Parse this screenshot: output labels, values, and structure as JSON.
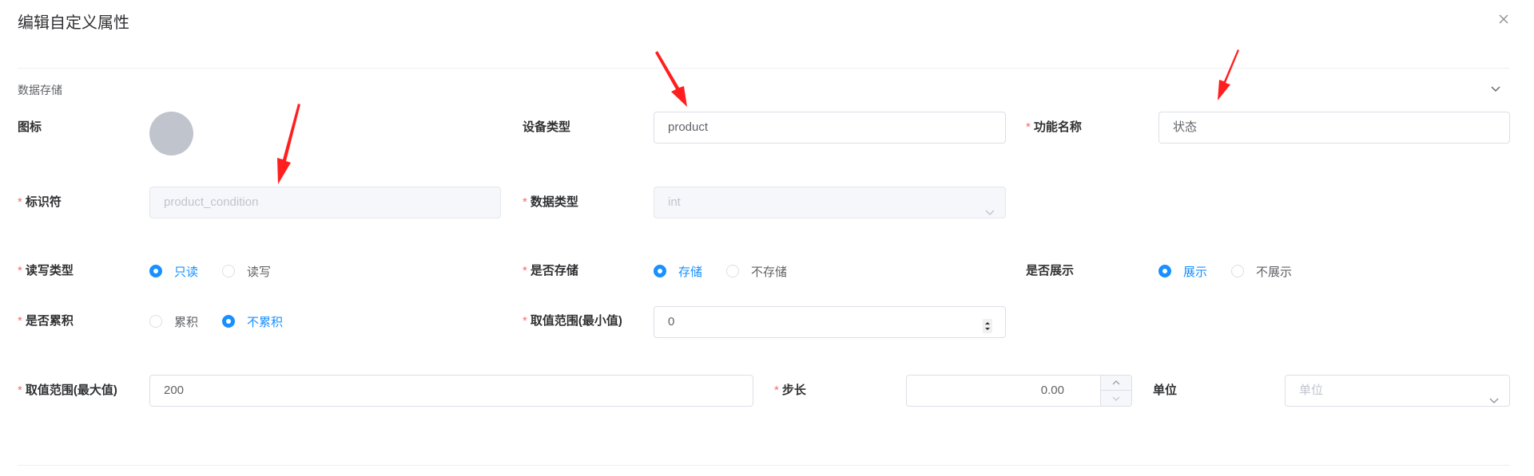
{
  "dialog": {
    "title": "编辑自定义属性"
  },
  "section": {
    "title": "数据存储"
  },
  "fields": {
    "icon": {
      "label": "图标"
    },
    "device_type": {
      "label": "设备类型",
      "value": "product"
    },
    "function_name": {
      "label": "功能名称",
      "required": "*",
      "value": "状态"
    },
    "identifier": {
      "label": "标识符",
      "required": "*",
      "value": "product_condition"
    },
    "data_type": {
      "label": "数据类型",
      "required": "*",
      "value": "int"
    },
    "rw_type": {
      "label": "读写类型",
      "required": "*",
      "options": [
        "只读",
        "读写"
      ],
      "selected": "只读"
    },
    "is_stored": {
      "label": "是否存储",
      "required": "*",
      "options": [
        "存储",
        "不存储"
      ],
      "selected": "存储"
    },
    "is_shown": {
      "label": "是否展示",
      "options": [
        "展示",
        "不展示"
      ],
      "selected": "展示"
    },
    "is_cumulative": {
      "label": "是否累积",
      "required": "*",
      "options": [
        "累积",
        "不累积"
      ],
      "selected": "不累积"
    },
    "range_min": {
      "label": "取值范围(最小值)",
      "required": "*",
      "value": "0"
    },
    "range_max": {
      "label": "取值范围(最大值)",
      "required": "*",
      "value": "200"
    },
    "step": {
      "label": "步长",
      "required": "*",
      "value": "0.00"
    },
    "unit": {
      "label": "单位",
      "placeholder": "单位"
    }
  },
  "colors": {
    "primary": "#1890ff",
    "required": "#f56c6c",
    "annotation_arrow": "#ff1f1f"
  }
}
